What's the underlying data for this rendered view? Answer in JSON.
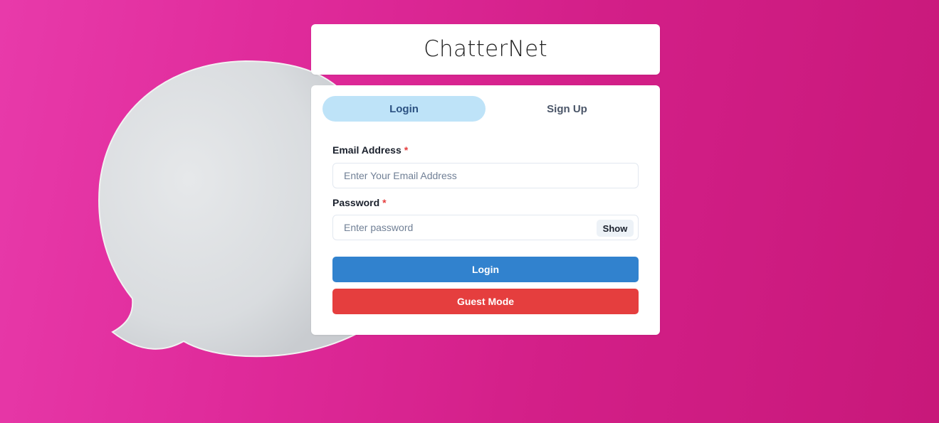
{
  "app": {
    "title": "ChatterNet"
  },
  "tabs": [
    {
      "label": "Login",
      "active": true
    },
    {
      "label": "Sign Up",
      "active": false
    }
  ],
  "form": {
    "email": {
      "label": "Email Address",
      "required_mark": "*",
      "placeholder": "Enter Your Email Address",
      "value": ""
    },
    "password": {
      "label": "Password",
      "required_mark": "*",
      "placeholder": "Enter password",
      "value": "",
      "toggle_label": "Show"
    },
    "login_button": "Login",
    "guest_button": "Guest Mode"
  },
  "background": {
    "image": "pink-paper-speech-bubble",
    "color": "#d6258f"
  },
  "colors": {
    "accent_blue": "#3182ce",
    "accent_red": "#e53e3e",
    "active_tab": "#bee3f8"
  }
}
